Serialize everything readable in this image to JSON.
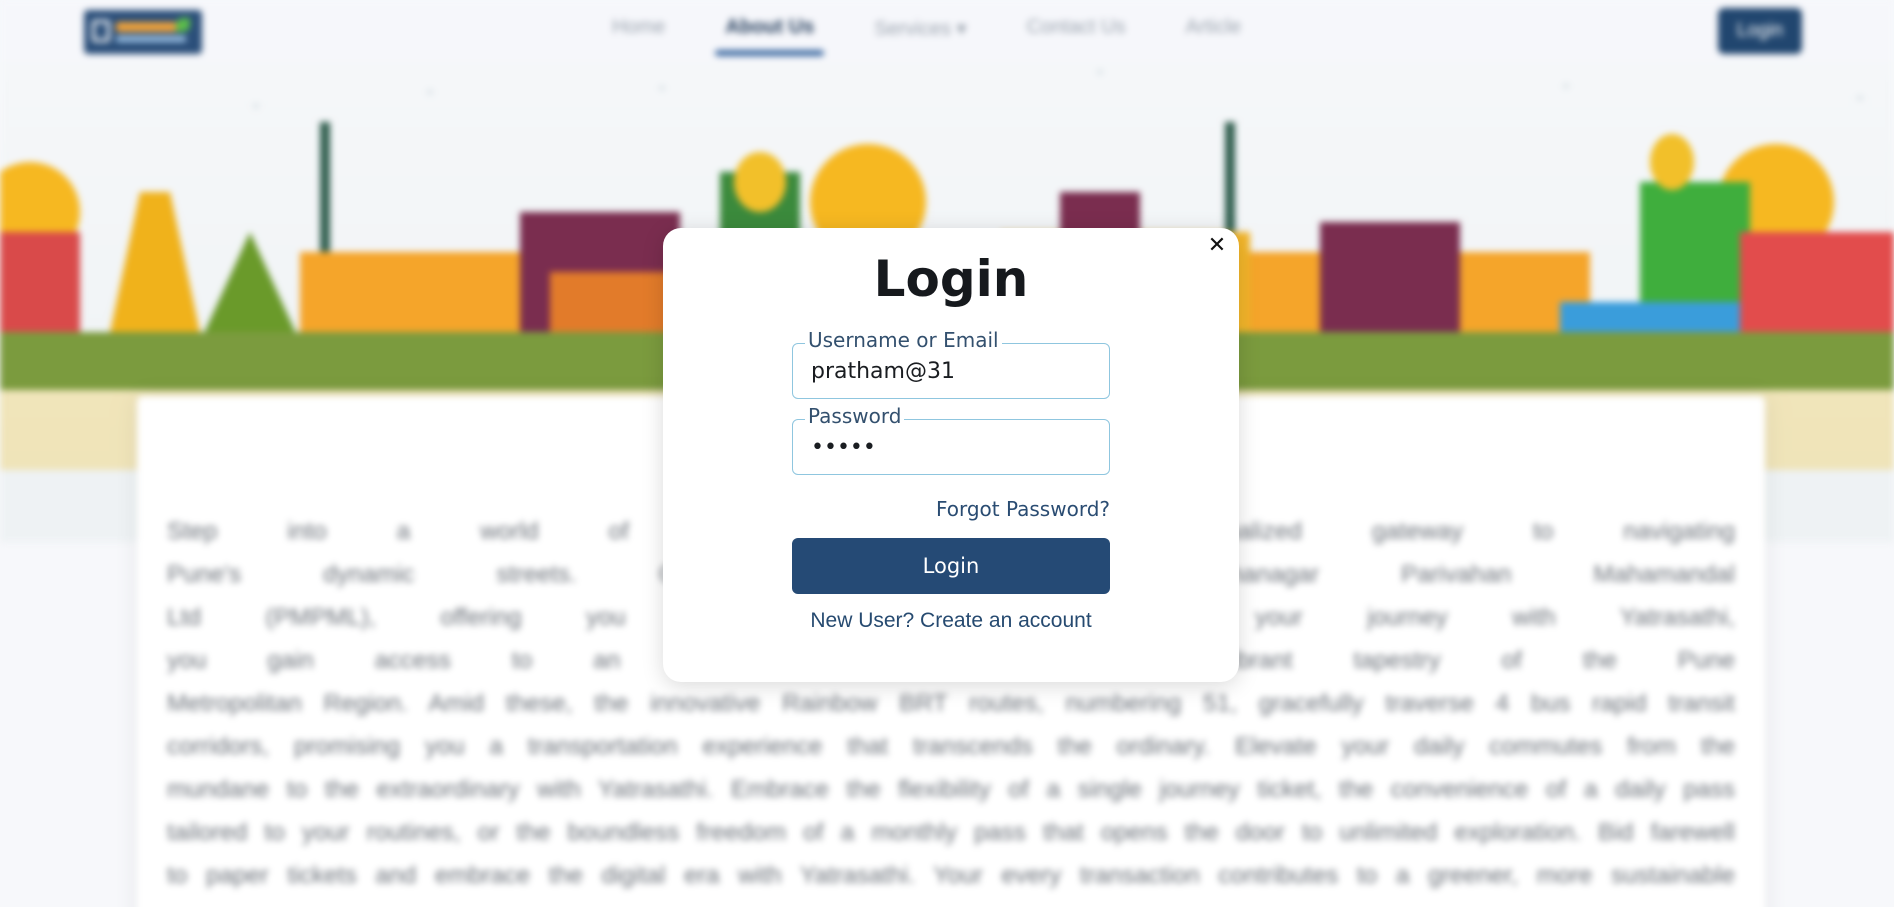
{
  "navbar": {
    "logo_icon": "yatrasathi-logo",
    "links": [
      "Home",
      "About Us",
      "Services",
      "Contact Us",
      "Article"
    ],
    "services_caret": "▾",
    "login_label": "Login"
  },
  "about": {
    "lines": [
      "Step into a world of modern convenienc                                          your personalized gateway to navigating",
      "Pune's dynamic streets. Our digital platf                                         Pune Mahanagar Parivahan Mahamandal",
      "Ltd (PMPML), offering you a tailored pas                                          embark on your journey with Yatrasathi,",
      "you gain access to an extensive networ                                          through the vibrant tapestry of the Pune",
      "Metropolitan Region. Amid these, the innovative Rainbow BRT routes, numbering 51, gracefully traverse 4 bus rapid transit",
      "corridors, promising you a transportation experience that transcends the ordinary. Elevate your daily commutes from the",
      "mundane to the extraordinary with Yatrasathi. Embrace the flexibility of a single journey ticket, the convenience of a daily pass",
      "tailored to your routines, or the boundless freedom of a monthly pass that opens the door to unlimited exploration. Bid farewell",
      "to paper tickets and embrace the digital era with Yatrasathi. Your every transaction contributes to a greener, more sustainable"
    ]
  },
  "modal": {
    "title": "Login",
    "close_symbol": "✕",
    "username_label": "Username or Email",
    "username_value": "pratham@31",
    "password_label": "Password",
    "password_value": "•••••",
    "forgot_label": "Forgot Password?",
    "submit_label": "Login",
    "signup_label": "New User? Create an account"
  },
  "colors": {
    "primary": "#254a75",
    "link": "#2a4c72",
    "field_border": "#8fc6df"
  }
}
